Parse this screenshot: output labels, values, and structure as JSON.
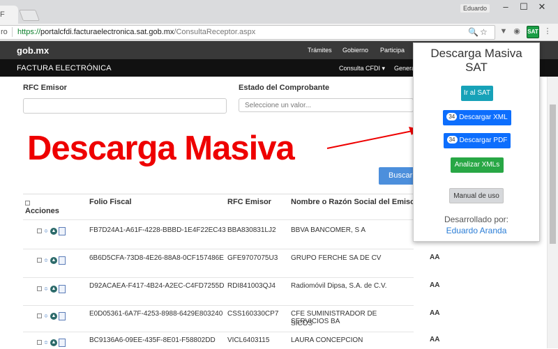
{
  "browser": {
    "tab_title": "F",
    "user": "Eduardo",
    "window_controls": [
      "minimize-icon",
      "maximize-icon",
      "close-icon"
    ],
    "url_label": "ro",
    "url_scheme": "https://",
    "url_host": "portalcfdi.facturaelectronica.sat.gob.mx",
    "url_path": "/ConsultaReceptor.aspx",
    "sat_ext_label": "SAT"
  },
  "site": {
    "logo": "gob.mx",
    "nav": [
      "Trámites",
      "Gobierno",
      "Participa"
    ],
    "subtitle": "FACTURA ELECTRÓNICA",
    "subnav": [
      "Consulta CFDI ▾",
      "Genera"
    ]
  },
  "filters": {
    "rfc_label": "RFC Emisor",
    "estado_label": "Estado del Comprobante",
    "estado_placeholder": "Seleccione un valor...",
    "search_label": "Buscar C"
  },
  "headline": "Descarga Masiva",
  "table": {
    "headers": {
      "actions": "Acciones",
      "folio": "Folio Fiscal",
      "rfc": "RFC Emisor",
      "nombre": "Nombre o Razón Social del Emisor"
    },
    "rows": [
      {
        "folio": "FB7D24A1-A61F-4228-BBBD-1E4F22EC43",
        "rfc": "BBA830831LJ2",
        "nombre": "BBVA BANCOMER, S A",
        "extra": ""
      },
      {
        "folio": "6B6D5CFA-73D8-4E26-88A8-0CF157486E",
        "rfc": "GFE9707075U3",
        "nombre": "GRUPO FERCHE SA DE CV",
        "extra": "AA"
      },
      {
        "folio": "D92ACAEA-F417-4B24-A2EC-C4FD7255D",
        "rfc": "RDI841003QJ4",
        "nombre": "Radiomóvil Dipsa, S.A. de C.V.",
        "extra": "AA"
      },
      {
        "folio": "E0D05361-6A7F-4253-8988-6429E803240",
        "rfc": "CSS160330CP7",
        "nombre": "CFE SUMINISTRADOR DE SERVICIOS BA",
        "nombre2": "SICOS",
        "extra": "AA"
      },
      {
        "folio": "BC9136A6-09EE-435F-8E01-F58802DD",
        "rfc": "VICL6403115",
        "nombre": "LAURA CONCEPCION",
        "extra": "AA"
      }
    ]
  },
  "popup": {
    "title_line1": "Descarga Masiva",
    "title_line2": "SAT",
    "ir_sat": "Ir al SAT",
    "xml_count": "34",
    "xml_label": "Descargar XML",
    "pdf_count": "34",
    "pdf_label": "Descargar PDF",
    "analizar": "Analizar XMLs",
    "manual": "Manual de uso",
    "dev_label": "Desarrollado por:",
    "author": "Eduardo Aranda"
  },
  "colors": {
    "headline": "#ee0000",
    "primary_button": "#0d6efd",
    "info_button": "#17a2b8",
    "success_button": "#28a745",
    "link": "#2a7dd6"
  }
}
